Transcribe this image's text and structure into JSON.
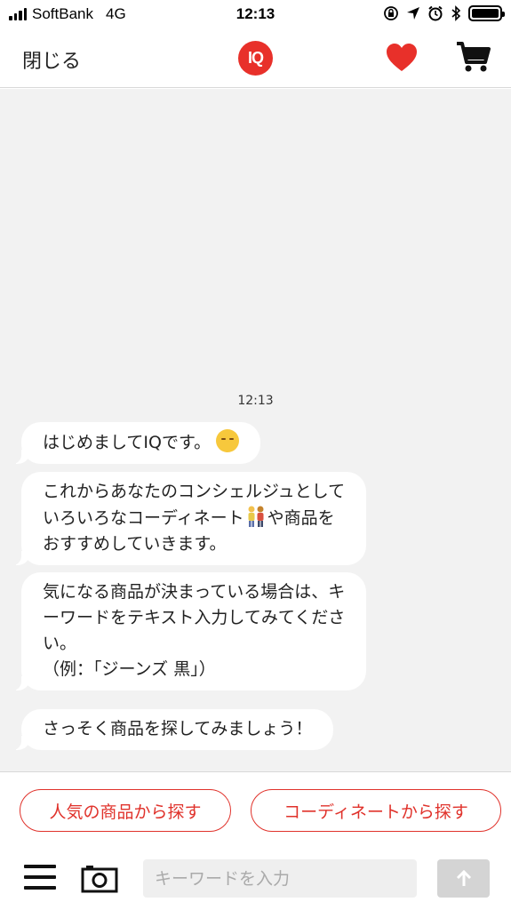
{
  "status_bar": {
    "carrier": "SoftBank",
    "network": "4G",
    "time": "12:13"
  },
  "nav": {
    "close_label": "閉じる",
    "logo_text": "IQ",
    "brand_color": "#e8302a"
  },
  "chat": {
    "timestamp": "12:13",
    "messages": [
      {
        "lines": [
          "はじめましてIQです。"
        ],
        "emoji": "smiling-face"
      },
      {
        "lines": [
          "これからあなたのコンシェルジュとして",
          "いろいろなコーディネート",
          "や商品を",
          "おすすめしていきます。"
        ],
        "emoji": "couple"
      },
      {
        "lines": [
          "気になる商品が決まっている場合は、キ",
          "ーワードをテキスト入力してみてくださ",
          "い。",
          "（例：「ジーンズ 黒」）"
        ]
      },
      {
        "lines": [
          "さっそく商品を探してみましょう！"
        ]
      }
    ]
  },
  "quick_replies": [
    "人気の商品から探す",
    "コーディネートから探す"
  ],
  "input": {
    "placeholder": "キーワードを入力",
    "value": ""
  },
  "icons": {
    "heart": "heart-icon",
    "cart": "cart-icon",
    "menu": "menu-icon",
    "camera": "camera-icon",
    "send": "arrow-up-icon"
  }
}
